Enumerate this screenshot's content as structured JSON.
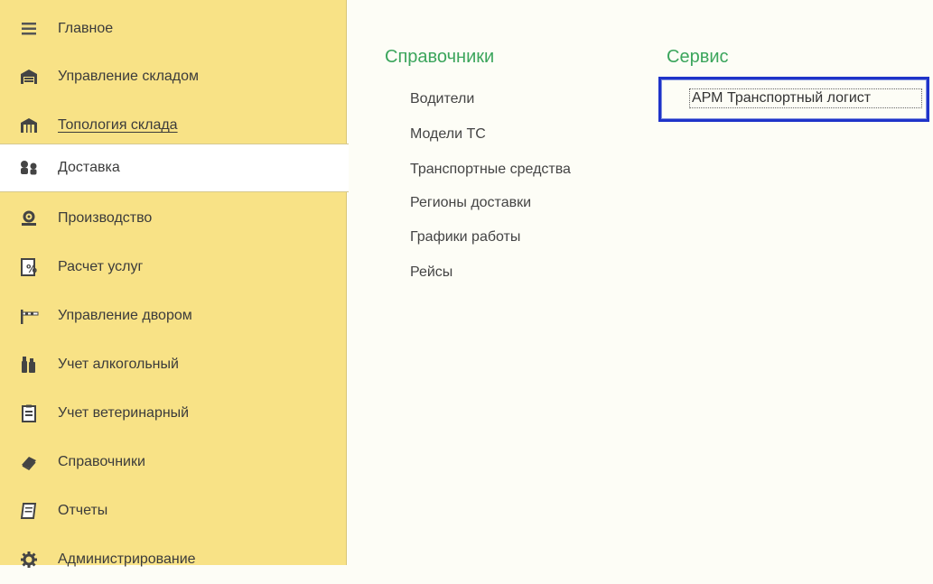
{
  "sidebar": {
    "items": [
      {
        "label": "Главное",
        "icon": "menu-lines-icon"
      },
      {
        "label": "Управление складом",
        "icon": "warehouse-icon"
      },
      {
        "label": "Топология склада",
        "icon": "warehouse-topology-icon"
      },
      {
        "label": "Доставка",
        "icon": "delivery-people-icon"
      },
      {
        "label": "Производство",
        "icon": "production-icon"
      },
      {
        "label": "Расчет услуг",
        "icon": "services-calc-icon"
      },
      {
        "label": "Управление двором",
        "icon": "yard-barrier-icon"
      },
      {
        "label": "Учет алкогольный",
        "icon": "alcohol-bottles-icon"
      },
      {
        "label": "Учет ветеринарный",
        "icon": "vet-clipboard-icon"
      },
      {
        "label": "Справочники",
        "icon": "book-icon"
      },
      {
        "label": "Отчеты",
        "icon": "reports-icon"
      },
      {
        "label": "Администрирование",
        "icon": "gear-icon"
      }
    ],
    "active_index": 3
  },
  "main": {
    "sections": [
      {
        "title": "Справочники",
        "links": [
          "Водители",
          "Модели ТС",
          "Транспортные средства",
          "Регионы доставки",
          "Графики работы",
          "Рейсы"
        ]
      },
      {
        "title": "Сервис",
        "links": [
          "АРМ Транспортный логист"
        ]
      }
    ]
  },
  "colors": {
    "sidebar_bg": "#f8e286",
    "section_title": "#3ba55c",
    "focus_border": "#1f33c9"
  }
}
